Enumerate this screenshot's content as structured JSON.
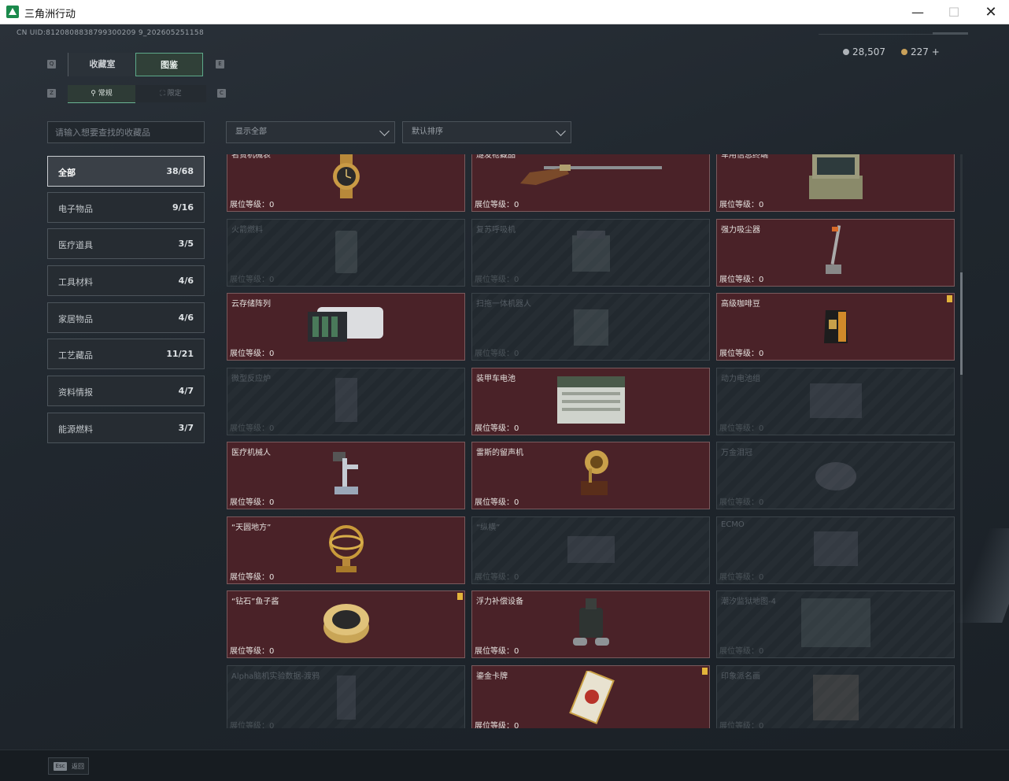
{
  "window": {
    "title": "三角洲行动",
    "min": "—",
    "max": "☐",
    "close": "✕"
  },
  "header": {
    "uid": "CN UID:8120808838799300209 9_202605251158",
    "currency": [
      {
        "icon": "silver-coin-icon",
        "value": "28,507"
      },
      {
        "icon": "gold-coin-icon",
        "value": "227 +"
      }
    ]
  },
  "tabs": [
    {
      "label": "收藏室"
    },
    {
      "label": "图鉴",
      "active": true
    }
  ],
  "tab_keys": {
    "left": "Q",
    "right": "E"
  },
  "subtabs": [
    {
      "label": "常规",
      "active": true
    },
    {
      "label": "限定"
    }
  ],
  "subtab_keys": {
    "left": "Z",
    "right": "C"
  },
  "search": {
    "placeholder": "请输入想要查找的收藏品"
  },
  "filters": {
    "show": "显示全部",
    "sort": "默认排序"
  },
  "categories": [
    {
      "label": "全部",
      "count": "38/68",
      "active": true
    },
    {
      "label": "电子物品",
      "count": "9/16"
    },
    {
      "label": "医疗道具",
      "count": "3/5"
    },
    {
      "label": "工具材料",
      "count": "4/6"
    },
    {
      "label": "家居物品",
      "count": "4/6"
    },
    {
      "label": "工艺藏品",
      "count": "11/21"
    },
    {
      "label": "资料情报",
      "count": "4/7"
    },
    {
      "label": "能源燃料",
      "count": "3/7"
    }
  ],
  "level_label": "展位等级：0",
  "items": [
    {
      "name": "名贵机械表",
      "owned": true,
      "icon": "watch-icon"
    },
    {
      "name": "燧发枪藏品",
      "owned": true,
      "icon": "flintlock-rifle-icon"
    },
    {
      "name": "军用信息终端",
      "owned": true,
      "icon": "military-terminal-icon"
    },
    {
      "name": "火箭燃料",
      "owned": false,
      "icon": "rocket-fuel-icon"
    },
    {
      "name": "复苏呼吸机",
      "owned": false,
      "icon": "ventilator-icon"
    },
    {
      "name": "强力吸尘器",
      "owned": true,
      "icon": "vacuum-cleaner-icon"
    },
    {
      "name": "云存储阵列",
      "owned": true,
      "icon": "storage-array-icon"
    },
    {
      "name": "扫拖一体机器人",
      "owned": false,
      "icon": "robot-vacuum-icon"
    },
    {
      "name": "高级咖啡豆",
      "owned": true,
      "icon": "coffee-bag-icon",
      "badge": true
    },
    {
      "name": "微型反应炉",
      "owned": false,
      "icon": "micro-reactor-icon"
    },
    {
      "name": "装甲车电池",
      "owned": true,
      "icon": "vehicle-battery-icon"
    },
    {
      "name": "动力电池组",
      "owned": false,
      "icon": "battery-pack-icon"
    },
    {
      "name": "医疗机械人",
      "owned": true,
      "icon": "medical-robot-icon"
    },
    {
      "name": "雷斯的留声机",
      "owned": true,
      "icon": "gramophone-icon"
    },
    {
      "name": "万金泪冠",
      "owned": false,
      "icon": "crown-icon"
    },
    {
      "name": "“天圆地方”",
      "owned": true,
      "icon": "armillary-sphere-icon"
    },
    {
      "name": "“纵横”",
      "owned": false,
      "icon": "chessboard-icon"
    },
    {
      "name": "ECMO",
      "owned": false,
      "icon": "ecmo-icon"
    },
    {
      "name": "“钻石”鱼子酱",
      "owned": true,
      "icon": "caviar-tin-icon",
      "badge": true
    },
    {
      "name": "浮力补偿设备",
      "owned": true,
      "icon": "buoyancy-device-icon"
    },
    {
      "name": "潮汐监狱地图-4",
      "owned": false,
      "icon": "map-icon"
    },
    {
      "name": "Alpha脑机实验数据-渡鸦",
      "owned": false,
      "icon": "brain-data-icon"
    },
    {
      "name": "鎏金卡牌",
      "owned": true,
      "icon": "gilded-card-icon",
      "badge": true
    },
    {
      "name": "印象派名画",
      "owned": false,
      "icon": "painting-icon"
    }
  ],
  "footer": {
    "esc_key": "Esc",
    "esc_label": "返回"
  },
  "colors": {
    "owned_bg": "#4a2228",
    "accent_green": "#5da98a",
    "badge": "#e3b43a"
  }
}
